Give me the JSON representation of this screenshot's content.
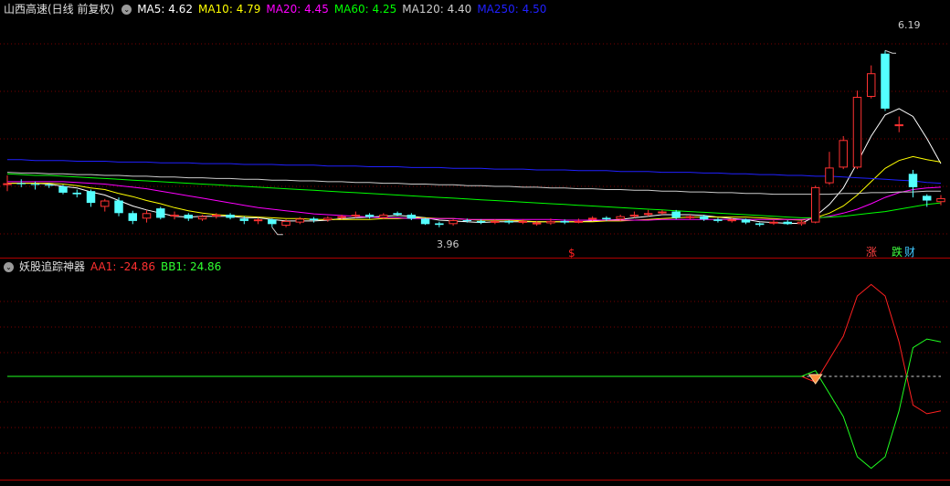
{
  "main_header": {
    "title": "山西高速(日线 前复权)",
    "indicators": [
      {
        "label": "MA5:",
        "value": "4.62",
        "color": "#ffffff"
      },
      {
        "label": "MA10:",
        "value": "4.79",
        "color": "#ffff00"
      },
      {
        "label": "MA20:",
        "value": "4.45",
        "color": "#ff00ff"
      },
      {
        "label": "MA60:",
        "value": "4.25",
        "color": "#00ff00"
      },
      {
        "label": "MA120:",
        "value": "4.40",
        "color": "#cccccc"
      },
      {
        "label": "MA250:",
        "value": "4.50",
        "color": "#2020ff"
      }
    ]
  },
  "sub_header": {
    "title": "妖股追踪神器",
    "indicators": [
      {
        "label": "AA1:",
        "value": "-24.86",
        "color": "#ff3030"
      },
      {
        "label": "BB1:",
        "value": "24.86",
        "color": "#30ff30"
      }
    ]
  },
  "chart_data": [
    {
      "type": "candlestick",
      "title": "山西高速(日线 前复权)",
      "ylim": [
        3.6,
        6.6
      ],
      "annotations": {
        "high_label": "6.19",
        "low_label": "3.96",
        "markers": [
          "$",
          "涨",
          "跌",
          "财"
        ]
      },
      "candles": [
        [
          4.5,
          4.5,
          4.6,
          4.4
        ],
        [
          4.5,
          4.49,
          4.55,
          4.45
        ],
        [
          4.49,
          4.48,
          4.52,
          4.42
        ],
        [
          4.48,
          4.47,
          4.5,
          4.44
        ],
        [
          4.46,
          4.38,
          4.48,
          4.36
        ],
        [
          4.38,
          4.36,
          4.42,
          4.32
        ],
        [
          4.4,
          4.25,
          4.42,
          4.2
        ],
        [
          4.2,
          4.28,
          4.3,
          4.14
        ],
        [
          4.28,
          4.12,
          4.32,
          4.08
        ],
        [
          4.12,
          4.02,
          4.15,
          3.98
        ],
        [
          4.05,
          4.12,
          4.16,
          4.0
        ],
        [
          4.18,
          4.06,
          4.2,
          4.04
        ],
        [
          4.08,
          4.1,
          4.14,
          4.04
        ],
        [
          4.1,
          4.05,
          4.12,
          4.02
        ],
        [
          4.04,
          4.08,
          4.1,
          4.02
        ],
        [
          4.08,
          4.1,
          4.12,
          4.05
        ],
        [
          4.1,
          4.06,
          4.12,
          4.04
        ],
        [
          4.05,
          4.02,
          4.08,
          3.98
        ],
        [
          4.02,
          4.04,
          4.06,
          3.98
        ],
        [
          4.04,
          3.98,
          4.05,
          3.94
        ],
        [
          3.96,
          4.02,
          4.04,
          3.94
        ],
        [
          4.0,
          4.05,
          4.07,
          3.98
        ],
        [
          4.05,
          4.03,
          4.07,
          4.0
        ],
        [
          4.03,
          4.06,
          4.08,
          4.01
        ],
        [
          4.06,
          4.08,
          4.1,
          4.04
        ],
        [
          4.08,
          4.1,
          4.14,
          4.06
        ],
        [
          4.1,
          4.07,
          4.12,
          4.05
        ],
        [
          4.06,
          4.1,
          4.12,
          4.04
        ],
        [
          4.12,
          4.1,
          4.14,
          4.08
        ],
        [
          4.1,
          4.05,
          4.12,
          4.03
        ],
        [
          4.05,
          3.98,
          4.06,
          3.97
        ],
        [
          3.99,
          3.97,
          4.01,
          3.94
        ],
        [
          3.98,
          4.03,
          4.04,
          3.96
        ],
        [
          4.03,
          4.02,
          4.05,
          4.0
        ],
        [
          4.02,
          4.0,
          4.04,
          3.98
        ],
        [
          4.0,
          4.02,
          4.04,
          3.98
        ],
        [
          4.02,
          4.0,
          4.03,
          3.98
        ],
        [
          4.0,
          4.02,
          4.04,
          3.98
        ],
        [
          3.98,
          4.0,
          4.02,
          3.96
        ],
        [
          3.99,
          4.02,
          4.05,
          3.97
        ],
        [
          4.02,
          4.0,
          4.04,
          3.98
        ],
        [
          4.0,
          4.02,
          4.05,
          3.99
        ],
        [
          4.04,
          4.06,
          4.08,
          4.02
        ],
        [
          4.06,
          4.04,
          4.08,
          4.02
        ],
        [
          4.04,
          4.08,
          4.1,
          4.02
        ],
        [
          4.08,
          4.1,
          4.14,
          4.06
        ],
        [
          4.1,
          4.12,
          4.16,
          4.08
        ],
        [
          4.12,
          4.14,
          4.16,
          4.1
        ],
        [
          4.14,
          4.06,
          4.16,
          4.04
        ],
        [
          4.06,
          4.08,
          4.1,
          4.04
        ],
        [
          4.08,
          4.04,
          4.1,
          4.02
        ],
        [
          4.04,
          4.02,
          4.06,
          4.0
        ],
        [
          4.02,
          4.04,
          4.06,
          4.0
        ],
        [
          4.04,
          4.0,
          4.05,
          3.98
        ],
        [
          3.99,
          3.97,
          4.0,
          3.95
        ],
        [
          3.99,
          4.01,
          4.03,
          3.97
        ],
        [
          4.01,
          3.98,
          4.03,
          3.97
        ],
        [
          3.98,
          4.01,
          4.03,
          3.96
        ],
        [
          4.0,
          4.45,
          4.47,
          3.99
        ],
        [
          4.5,
          4.7,
          4.9,
          4.48
        ],
        [
          4.7,
          5.05,
          5.1,
          4.68
        ],
        [
          4.7,
          5.6,
          5.68,
          4.68
        ],
        [
          5.6,
          5.9,
          6.0,
          5.58
        ],
        [
          6.15,
          5.45,
          6.19,
          5.42
        ],
        [
          5.25,
          5.25,
          5.35,
          5.15
        ],
        [
          4.62,
          4.45,
          4.67,
          4.32
        ],
        [
          4.34,
          4.28,
          4.36,
          4.2
        ],
        [
          4.26,
          4.31,
          4.35,
          4.22
        ]
      ],
      "series": [
        {
          "name": "MA5",
          "color": "#ffffff",
          "values": [
            4.5,
            4.5,
            4.5,
            4.49,
            4.46,
            4.44,
            4.39,
            4.35,
            4.28,
            4.21,
            4.16,
            4.12,
            4.08,
            4.07,
            4.08,
            4.08,
            4.08,
            4.06,
            4.06,
            4.04,
            4.02,
            4.02,
            4.02,
            4.03,
            4.05,
            4.06,
            4.07,
            4.08,
            4.09,
            4.08,
            4.06,
            4.03,
            4.02,
            4.01,
            4.0,
            4.01,
            4.01,
            4.01,
            4.01,
            4.01,
            4.01,
            4.01,
            4.02,
            4.03,
            4.04,
            4.06,
            4.08,
            4.1,
            4.1,
            4.1,
            4.09,
            4.07,
            4.05,
            4.04,
            4.01,
            4.0,
            3.99,
            3.99,
            4.08,
            4.23,
            4.44,
            4.76,
            5.1,
            5.37,
            5.45,
            5.35,
            5.07,
            4.75
          ]
        },
        {
          "name": "MA10",
          "color": "#ffff00",
          "values": [
            4.5,
            4.5,
            4.5,
            4.5,
            4.49,
            4.47,
            4.44,
            4.42,
            4.37,
            4.33,
            4.28,
            4.24,
            4.19,
            4.15,
            4.12,
            4.1,
            4.09,
            4.08,
            4.07,
            4.06,
            4.05,
            4.05,
            4.04,
            4.04,
            4.04,
            4.04,
            4.04,
            4.05,
            4.05,
            4.06,
            4.06,
            4.05,
            4.05,
            4.04,
            4.03,
            4.03,
            4.03,
            4.02,
            4.01,
            4.01,
            4.01,
            4.01,
            4.01,
            4.02,
            4.02,
            4.03,
            4.04,
            4.05,
            4.06,
            4.07,
            4.07,
            4.07,
            4.07,
            4.07,
            4.06,
            4.05,
            4.04,
            4.03,
            4.06,
            4.12,
            4.21,
            4.35,
            4.52,
            4.69,
            4.79,
            4.84,
            4.8,
            4.77
          ]
        },
        {
          "name": "MA20",
          "color": "#ff00ff",
          "values": [
            4.52,
            4.52,
            4.52,
            4.52,
            4.52,
            4.51,
            4.5,
            4.49,
            4.47,
            4.45,
            4.43,
            4.4,
            4.37,
            4.34,
            4.31,
            4.28,
            4.25,
            4.22,
            4.19,
            4.17,
            4.15,
            4.13,
            4.11,
            4.1,
            4.09,
            4.08,
            4.07,
            4.06,
            4.06,
            4.05,
            4.05,
            4.05,
            4.05,
            4.04,
            4.04,
            4.04,
            4.04,
            4.04,
            4.04,
            4.04,
            4.03,
            4.03,
            4.03,
            4.03,
            4.03,
            4.03,
            4.03,
            4.04,
            4.04,
            4.04,
            4.04,
            4.04,
            4.04,
            4.04,
            4.04,
            4.04,
            4.04,
            4.04,
            4.05,
            4.08,
            4.12,
            4.17,
            4.24,
            4.32,
            4.38,
            4.42,
            4.44,
            4.45
          ]
        },
        {
          "name": "MA60",
          "color": "#00ff00",
          "values": [
            4.62,
            4.61,
            4.6,
            4.6,
            4.59,
            4.58,
            4.57,
            4.56,
            4.55,
            4.54,
            4.53,
            4.52,
            4.51,
            4.5,
            4.49,
            4.48,
            4.47,
            4.46,
            4.45,
            4.44,
            4.43,
            4.42,
            4.41,
            4.4,
            4.39,
            4.38,
            4.37,
            4.36,
            4.35,
            4.34,
            4.33,
            4.32,
            4.31,
            4.3,
            4.29,
            4.28,
            4.27,
            4.26,
            4.25,
            4.24,
            4.23,
            4.22,
            4.21,
            4.2,
            4.19,
            4.18,
            4.17,
            4.16,
            4.15,
            4.14,
            4.13,
            4.12,
            4.11,
            4.1,
            4.09,
            4.08,
            4.07,
            4.06,
            4.06,
            4.07,
            4.08,
            4.1,
            4.12,
            4.14,
            4.17,
            4.2,
            4.23,
            4.25
          ]
        },
        {
          "name": "MA120",
          "color": "#cccccc",
          "values": [
            4.64,
            4.63,
            4.63,
            4.62,
            4.62,
            4.61,
            4.61,
            4.6,
            4.6,
            4.59,
            4.59,
            4.58,
            4.58,
            4.57,
            4.57,
            4.56,
            4.56,
            4.55,
            4.55,
            4.54,
            4.54,
            4.53,
            4.53,
            4.52,
            4.52,
            4.51,
            4.51,
            4.5,
            4.5,
            4.49,
            4.49,
            4.48,
            4.48,
            4.47,
            4.47,
            4.46,
            4.46,
            4.45,
            4.45,
            4.44,
            4.44,
            4.43,
            4.43,
            4.42,
            4.42,
            4.41,
            4.41,
            4.4,
            4.4,
            4.39,
            4.39,
            4.38,
            4.38,
            4.37,
            4.37,
            4.36,
            4.36,
            4.36,
            4.36,
            4.36,
            4.37,
            4.37,
            4.38,
            4.38,
            4.39,
            4.39,
            4.4,
            4.4
          ]
        },
        {
          "name": "MA250",
          "color": "#2020ff",
          "values": [
            4.8,
            4.8,
            4.79,
            4.79,
            4.79,
            4.78,
            4.78,
            4.78,
            4.77,
            4.77,
            4.77,
            4.76,
            4.76,
            4.76,
            4.75,
            4.75,
            4.75,
            4.74,
            4.74,
            4.74,
            4.73,
            4.73,
            4.73,
            4.72,
            4.72,
            4.72,
            4.71,
            4.71,
            4.71,
            4.7,
            4.7,
            4.7,
            4.69,
            4.69,
            4.69,
            4.68,
            4.68,
            4.68,
            4.67,
            4.67,
            4.67,
            4.66,
            4.66,
            4.66,
            4.65,
            4.65,
            4.65,
            4.64,
            4.64,
            4.64,
            4.63,
            4.63,
            4.62,
            4.62,
            4.61,
            4.61,
            4.6,
            4.6,
            4.59,
            4.59,
            4.58,
            4.57,
            4.56,
            4.55,
            4.54,
            4.53,
            4.51,
            4.5
          ]
        }
      ]
    },
    {
      "type": "line",
      "title": "妖股追踪神器",
      "ylim": [
        -35,
        35
      ],
      "series": [
        {
          "name": "AA1",
          "color": "#ff2020",
          "values": [
            0,
            0,
            0,
            0,
            0,
            0,
            0,
            0,
            0,
            0,
            0,
            0,
            0,
            0,
            0,
            0,
            0,
            0,
            0,
            0,
            0,
            0,
            0,
            0,
            0,
            0,
            0,
            0,
            0,
            0,
            0,
            0,
            0,
            0,
            0,
            0,
            0,
            0,
            0,
            0,
            0,
            0,
            0,
            0,
            0,
            0,
            0,
            0,
            0,
            0,
            0,
            0,
            0,
            0,
            0,
            0,
            0,
            0,
            -2,
            6,
            14,
            28,
            32,
            28,
            12,
            -10,
            -13,
            -12
          ]
        },
        {
          "name": "BB1",
          "color": "#20ff20",
          "values": [
            0,
            0,
            0,
            0,
            0,
            0,
            0,
            0,
            0,
            0,
            0,
            0,
            0,
            0,
            0,
            0,
            0,
            0,
            0,
            0,
            0,
            0,
            0,
            0,
            0,
            0,
            0,
            0,
            0,
            0,
            0,
            0,
            0,
            0,
            0,
            0,
            0,
            0,
            0,
            0,
            0,
            0,
            0,
            0,
            0,
            0,
            0,
            0,
            0,
            0,
            0,
            0,
            0,
            0,
            0,
            0,
            0,
            0,
            2,
            -6,
            -14,
            -28,
            -32,
            -28,
            -12,
            10,
            13,
            12
          ]
        }
      ]
    }
  ]
}
